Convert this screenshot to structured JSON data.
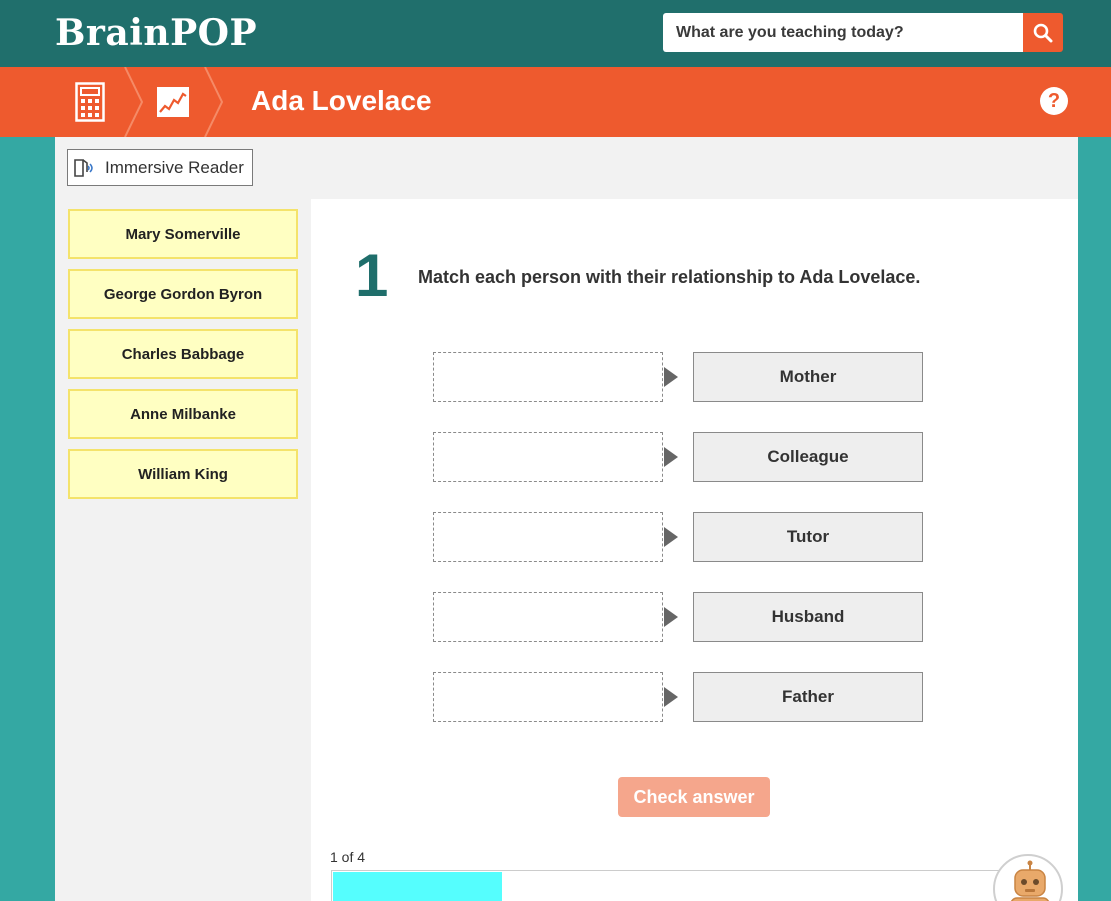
{
  "header": {
    "logo_text": "BrainPOP",
    "search": {
      "placeholder": "What are you teaching today?",
      "value": ""
    },
    "search_button_icon": "search-icon"
  },
  "breadcrumb": {
    "subject_icon": "calculator-icon",
    "unit_icon": "line-chart-icon",
    "topic_title": "Ada Lovelace",
    "help_label": "?"
  },
  "toolbar": {
    "immersive_reader_label": "Immersive Reader",
    "immersive_reader_icon": "immersive-reader-icon"
  },
  "answers": [
    {
      "label": "Mary Somerville"
    },
    {
      "label": "George Gordon Byron"
    },
    {
      "label": "Charles Babbage"
    },
    {
      "label": "Anne Milbanke"
    },
    {
      "label": "William King"
    }
  ],
  "question": {
    "number": "1",
    "text": "Match each person with their relationship to Ada Lovelace.",
    "targets": [
      {
        "label": "Mother"
      },
      {
        "label": "Colleague"
      },
      {
        "label": "Tutor"
      },
      {
        "label": "Husband"
      },
      {
        "label": "Father"
      }
    ]
  },
  "check_button_label": "Check answer",
  "progress": {
    "label": "1 of 4",
    "fraction": 0.25
  },
  "colors": {
    "teal_dark": "#206f6c",
    "teal_bg": "#34a8a3",
    "orange": "#ee5a2e",
    "card_yellow": "#ffffc2",
    "progress_cyan": "#55fefe"
  }
}
